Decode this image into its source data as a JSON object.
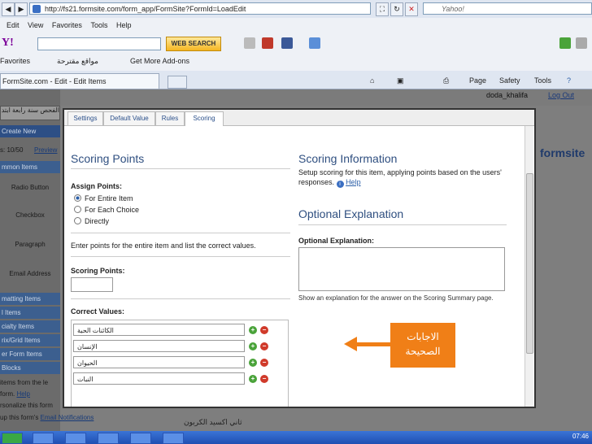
{
  "browser": {
    "url": "http://fs21.formsite.com/form_app/FormSite?FormId=LoadEdit",
    "search_placeholder": "Yahoo!",
    "menu": [
      "Edit",
      "View",
      "Favorites",
      "Tools",
      "Help"
    ],
    "web_search": "WEB SEARCH",
    "favorites": "Favorites",
    "suggested_sites": "مواقع مقترحة",
    "addons": "Get More Add-ons",
    "tab_title": "FormSite.com - Edit - Edit Items",
    "commands": [
      "Page",
      "Safety",
      "Tools"
    ],
    "clock": "07:46"
  },
  "background_page": {
    "user": "doda_khalifa",
    "logout": "Log Out",
    "form_title": "الفحص سنة رابعة ابتدائي",
    "create_new": "Create New",
    "items_count": "s: 10/50",
    "preview": "Preview",
    "brand": "formsite",
    "sections": [
      "mmon Items",
      "matting Items",
      "l Items",
      "cialty Items",
      "rix/Grid Items",
      "er Form Items",
      "Blocks"
    ],
    "common_items": [
      "Radio Button",
      "Checkbox",
      "Paragraph",
      "Email Address"
    ],
    "footer_lines": [
      "items from the le",
      "form. ",
      "rsonalize this form",
      "up this form's "
    ],
    "help": "Help",
    "email_notifications": "Email Notifications",
    "option_behind": "ثاني اكسيد الكربون"
  },
  "modal": {
    "tabs": [
      "Settings",
      "Default Value",
      "Rules",
      "Scoring"
    ],
    "active_tab": "Scoring",
    "scoring_points_heading": "Scoring Points",
    "assign_points_label": "Assign Points:",
    "assign_options": [
      "For Entire Item",
      "For Each Choice",
      "Directly"
    ],
    "selected_option": "For Entire Item",
    "instructions": "Enter points for the entire item and list the correct values.",
    "scoring_points_label": "Scoring Points:",
    "scoring_points_value": "",
    "correct_values_label": "Correct Values:",
    "correct_values": [
      "الكائنات الحية",
      "الإنسان",
      "الحيوان",
      "النبات"
    ],
    "scoring_info_heading": "Scoring Information",
    "scoring_info_text": "Setup scoring for this item, applying points based on the users' responses.",
    "help_link": "Help",
    "optional_heading": "Optional Explanation",
    "optional_label": "Optional Explanation:",
    "optional_value": "",
    "optional_note": "Show an explanation for the answer on the Scoring Summary page."
  },
  "annotation": {
    "text_line1": "الاجابات",
    "text_line2": "الصحيحة",
    "color": "#f07f17"
  }
}
